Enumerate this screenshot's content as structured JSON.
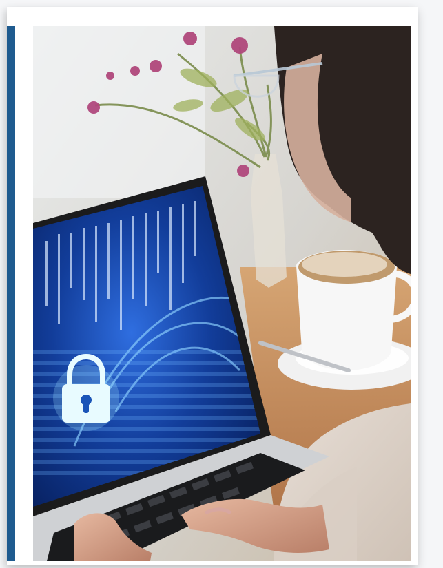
{
  "colors": {
    "spine": "#1f5b8f",
    "background": "#f5f6f8",
    "cardBorder": "#ffffff",
    "screenBlue": "#0d2a7a",
    "lockGlow": "#dff6ff"
  },
  "icons": {
    "screenIcon": "padlock-icon"
  }
}
